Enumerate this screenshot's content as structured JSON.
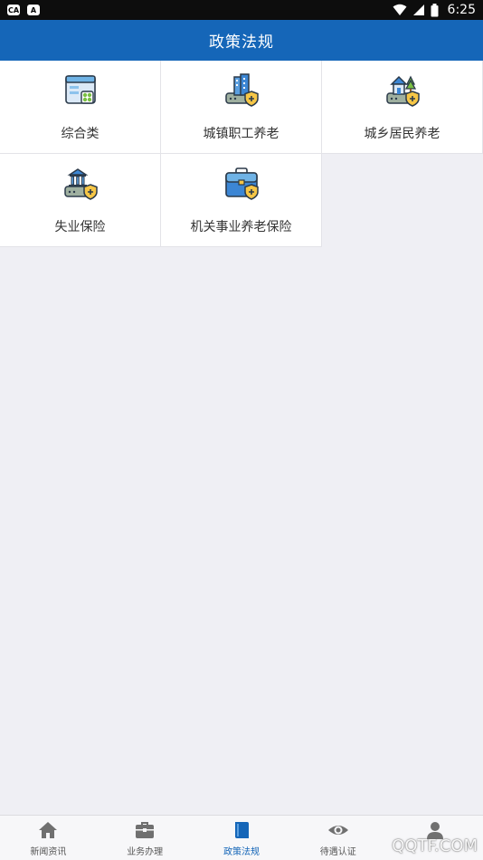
{
  "status_bar": {
    "left_badges": [
      "CA",
      "A"
    ],
    "time": "6:25",
    "icons": [
      "wifi-icon",
      "signal-icon",
      "battery-icon"
    ]
  },
  "header": {
    "title": "政策法规"
  },
  "grid": {
    "items": [
      {
        "label": "综合类",
        "icon": "document-icon"
      },
      {
        "label": "城镇职工养老",
        "icon": "city-building-shield-icon"
      },
      {
        "label": "城乡居民养老",
        "icon": "house-shield-icon"
      },
      {
        "label": "失业保险",
        "icon": "bank-shield-icon"
      },
      {
        "label": "机关事业养老保险",
        "icon": "briefcase-shield-icon"
      }
    ]
  },
  "bottom_nav": {
    "items": [
      {
        "label": "新闻资讯",
        "icon": "home-icon",
        "active": false
      },
      {
        "label": "业务办理",
        "icon": "briefcase-icon",
        "active": false
      },
      {
        "label": "政策法规",
        "icon": "book-icon",
        "active": true
      },
      {
        "label": "待遇认证",
        "icon": "eye-icon",
        "active": false
      },
      {
        "label": "",
        "icon": "person-icon",
        "active": false
      }
    ]
  },
  "colors": {
    "primary": "#1566b8",
    "background": "#efeff4",
    "nav_active": "#1566b8",
    "nav_inactive": "#555555"
  },
  "watermark": "QQTF.COM"
}
